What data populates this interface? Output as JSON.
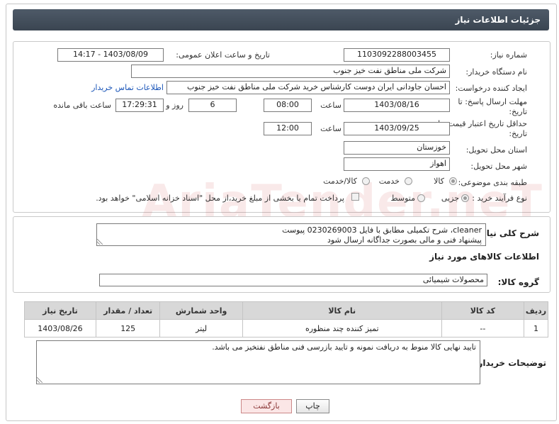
{
  "panel": {
    "title": "جزئیات اطلاعات نیاز"
  },
  "form": {
    "need_number_label": "شماره نیاز:",
    "need_number": "1103092288003455",
    "announce_label": "تاریخ و ساعت اعلان عمومی:",
    "announce_value": "1403/08/09 - 14:17",
    "buyer_org_label": "نام دستگاه خریدار:",
    "buyer_org": "شرکت ملی مناطق نفت خیز جنوب",
    "creator_label": "ایجاد کننده درخواست:",
    "creator": "احسان جاودانی ایران دوست کارشناس خرید شرکت ملی مناطق نفت خیز جنوب",
    "contact_link": "اطلاعات تماس خریدار",
    "deadline_label_1": "مهلت ارسال پاسخ: تا",
    "deadline_label_2": "تاریخ:",
    "deadline_date": "1403/08/16",
    "time_label": "ساعت",
    "deadline_time": "08:00",
    "days_value": "6",
    "days_label": "روز و",
    "remaining_time": "17:29:31",
    "remaining_label": "ساعت باقی مانده",
    "validity_label_1": "حداقل تاریخ اعتبار قیمت: تا",
    "validity_label_2": "تاریخ:",
    "validity_date": "1403/09/25",
    "validity_time": "12:00",
    "province_label": "استان محل تحویل:",
    "province": "خوزستان",
    "city_label": "شهر محل تحویل:",
    "city": "اهواز",
    "category_label": "طبقه بندی موضوعی:",
    "category_options": [
      "کالا",
      "خدمت",
      "کالا/خدمت"
    ],
    "process_label": "نوع فرآیند خرید :",
    "process_options": [
      "جزیی",
      "متوسط"
    ],
    "payment_note": "پرداخت تمام یا بخشی از مبلغ خرید،از محل \"اسناد خزانه اسلامی\" خواهد بود."
  },
  "description": {
    "label": "شرح کلی نیاز:",
    "line1": "cleaner، شرح تکمیلی مطابق با فایل 0230269003 پیوست",
    "line2": "پیشنهاد فنی و مالی بصورت جداگانه ارسال شود"
  },
  "goods": {
    "section_title": "اطلاعات کالاهای مورد نیاز",
    "group_label": "گروه کالا:",
    "group_value": "محصولات شیمیائی",
    "columns": [
      "ردیف",
      "کد کالا",
      "نام کالا",
      "واحد شمارش",
      "تعداد / مقدار",
      "تاریخ نیاز"
    ],
    "rows": [
      {
        "row": "1",
        "code": "--",
        "name": "تمیز کننده چند منظوره",
        "unit": "لیتر",
        "qty": "125",
        "date": "1403/08/26"
      }
    ]
  },
  "buyer_notes": {
    "label": "توضیحات خریدار:",
    "text": "تایید نهایی کالا منوط به دریافت نمونه و تایید بازرسی فنی مناطق نفتخیز می باشد."
  },
  "buttons": {
    "print": "چاپ",
    "back": "بازگشت"
  },
  "watermark": "AriaTender.neT",
  "colors": {
    "header_bg": "#3f4a57",
    "link": "#1a55b8",
    "back_button": "#fbe6e6"
  }
}
